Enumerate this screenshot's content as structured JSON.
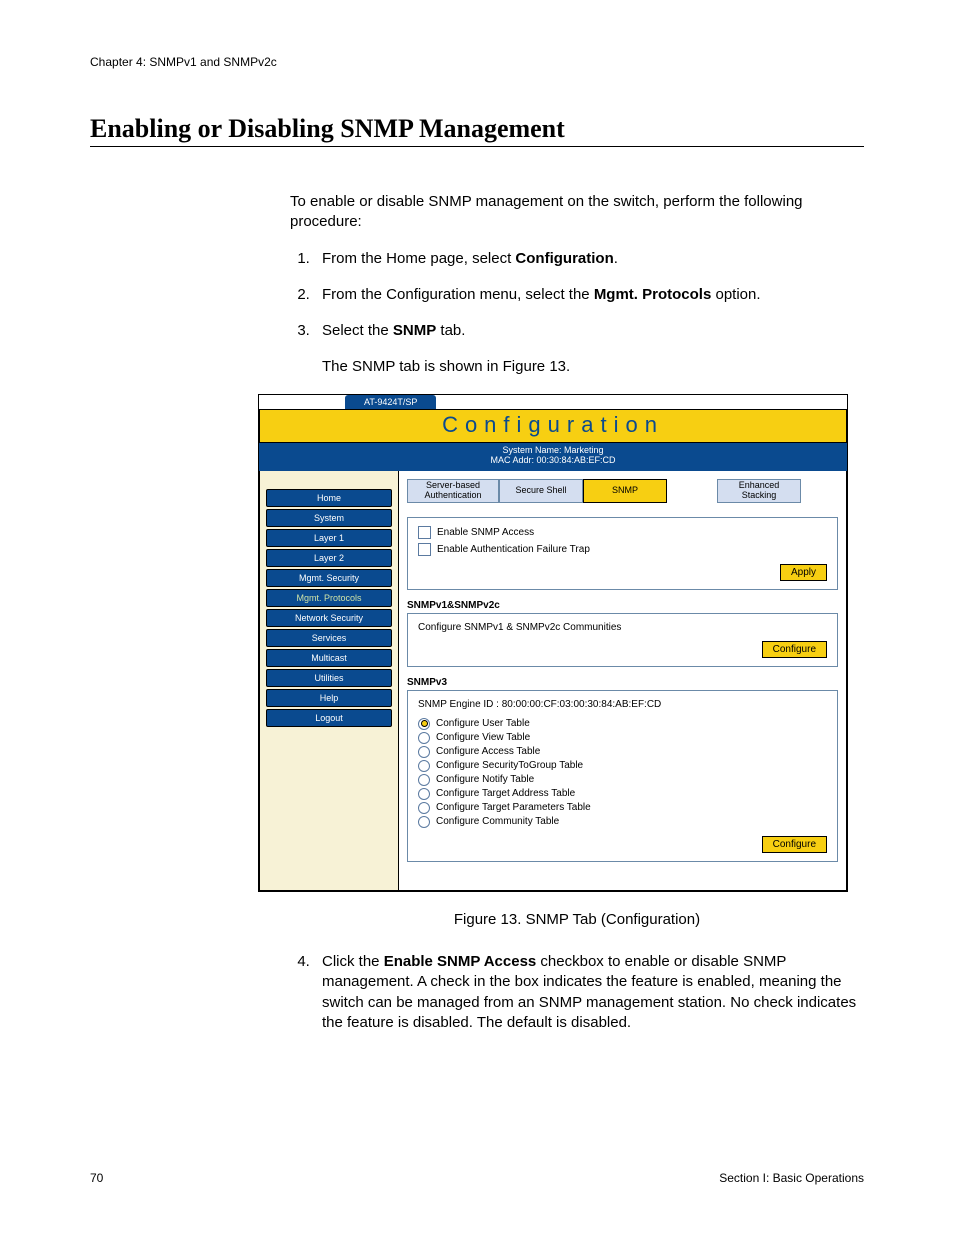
{
  "chapter_header": "Chapter 4: SNMPv1 and SNMPv2c",
  "section_title": "Enabling or Disabling SNMP Management",
  "intro": "To enable or disable SNMP management on the switch, perform the following procedure:",
  "steps": {
    "s1_a": "From the Home page, select ",
    "s1_b": "Configuration",
    "s1_c": ".",
    "s2_a": "From the Configuration menu, select the ",
    "s2_b": "Mgmt. Protocols",
    "s2_c": " option.",
    "s3_a": "Select the ",
    "s3_b": "SNMP",
    "s3_c": " tab.",
    "s3_extra": "The SNMP tab is shown in Figure 13.",
    "s4_a": "Click the ",
    "s4_b": "Enable SNMP Access",
    "s4_c": " checkbox to enable or disable SNMP management. A check in the box indicates the feature is enabled, meaning the switch can be managed from an SNMP management station. No check indicates the feature is disabled. The default is disabled."
  },
  "figure_caption": "Figure 13. SNMP Tab (Configuration)",
  "footer": {
    "left": "70",
    "right": "Section I: Basic Operations"
  },
  "app": {
    "model": "AT-9424T/SP",
    "page_title": "Configuration",
    "sys_name_line": "System Name: Marketing",
    "mac_line": "MAC Addr: 00:30:84:AB:EF:CD",
    "sidebar": {
      "items": [
        "Home",
        "System",
        "Layer 1",
        "Layer 2",
        "Mgmt. Security",
        "Mgmt. Protocols",
        "Network Security",
        "Services",
        "Multicast",
        "Utilities",
        "Help",
        "Logout"
      ],
      "selected_index": 5
    },
    "tabs": {
      "items": [
        {
          "label": "Server-based Authentication"
        },
        {
          "label": "Secure Shell"
        },
        {
          "label": "SNMP"
        },
        {
          "label": "Enhanced Stacking"
        }
      ],
      "active_index": 2
    },
    "checkboxes": {
      "c1": "Enable SNMP Access",
      "c2": "Enable Authentication Failure Trap"
    },
    "apply_label": "Apply",
    "snmp12": {
      "heading": "SNMPv1&SNMPv2c",
      "line": "Configure SNMPv1 & SNMPv2c Communities",
      "btn": "Configure"
    },
    "snmp3": {
      "heading": "SNMPv3",
      "engine_line": "SNMP Engine ID : 80:00:00:CF:03:00:30:84:AB:EF:CD",
      "options": [
        "Configure User Table",
        "Configure View Table",
        "Configure Access Table",
        "Configure SecurityToGroup Table",
        "Configure Notify Table",
        "Configure Target Address Table",
        "Configure Target Parameters Table",
        "Configure Community Table"
      ],
      "selected_index": 0,
      "btn": "Configure"
    }
  }
}
